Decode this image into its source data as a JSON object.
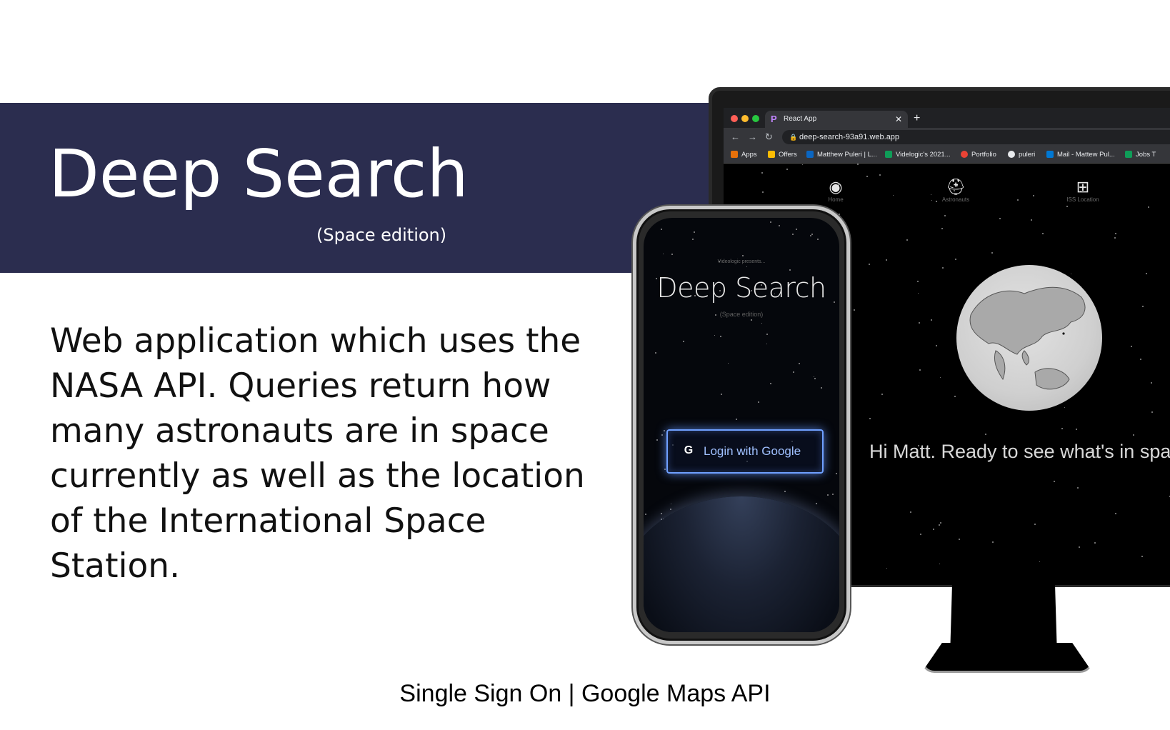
{
  "slide": {
    "title": "Deep Search",
    "subtitle": "(Space edition)",
    "description": "Web application which uses the NASA API. Queries return how many astronauts are in space currently as well as the location of the International Space Station.",
    "footer": "Single Sign On | Google Maps API",
    "banner_color": "#2b2d4f"
  },
  "browser": {
    "tab_title": "React App",
    "url": "deep-search-93a91.web.app",
    "bookmarks": [
      {
        "label": "Apps",
        "color": "#e8710a"
      },
      {
        "label": "Offers",
        "color": "#fbbc04"
      },
      {
        "label": "Matthew Puleri | L...",
        "color": "#0a66c2"
      },
      {
        "label": "Videlogic's 2021...",
        "color": "#0f9d58"
      },
      {
        "label": "Portfolio",
        "color": "#ea4335"
      },
      {
        "label": "puleri",
        "color": "#e8eaed"
      },
      {
        "label": "Mail - Mattew Pul...",
        "color": "#0078d4"
      },
      {
        "label": "Jobs T",
        "color": "#0f9d58"
      }
    ]
  },
  "webapp": {
    "nav": [
      {
        "icon": "globe-icon",
        "glyph": "◉",
        "label": "Home"
      },
      {
        "icon": "astronaut-icon",
        "glyph": "⛑",
        "label": "Astronauts"
      },
      {
        "icon": "satellite-icon",
        "glyph": "⊞",
        "label": "ISS Location"
      }
    ],
    "greeting": "Hi Matt. Ready to see what's in spac"
  },
  "phone": {
    "presents": "Videologic presents...",
    "title": "Deep Search",
    "subtitle": "(Space edition)",
    "login_label": "Login with Google",
    "accent": "#6fa0ff"
  }
}
